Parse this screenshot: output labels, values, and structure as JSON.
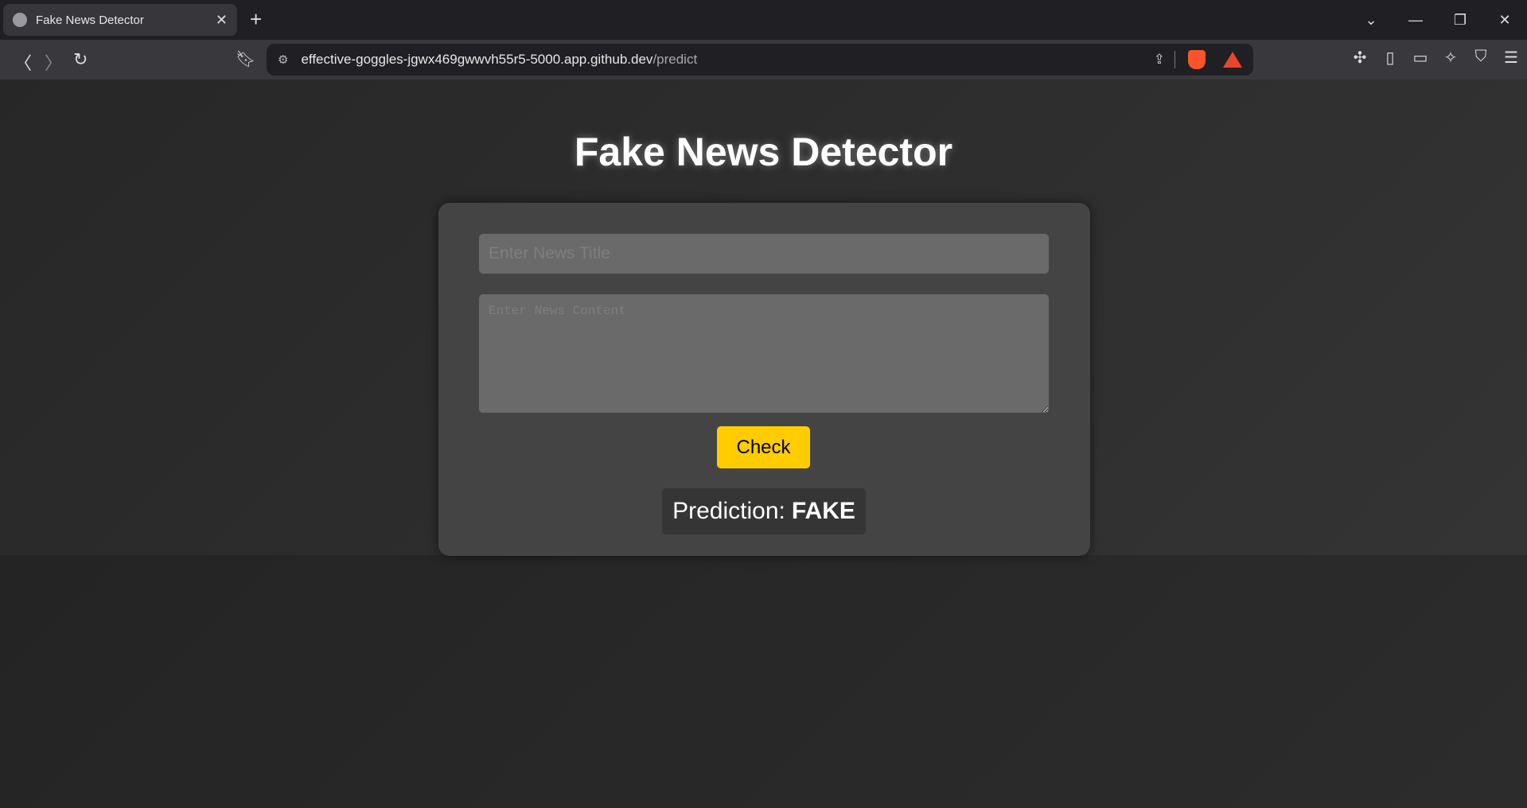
{
  "browser": {
    "tab": {
      "title": "Fake News Detector",
      "icon": "globe-icon"
    },
    "url": {
      "host": "effective-goggles-jgwx469gwwvh55r5-5000.app.github.dev",
      "path": "/predict"
    }
  },
  "page": {
    "title": "Fake News Detector",
    "title_input": {
      "placeholder": "Enter News Title",
      "value": ""
    },
    "content_input": {
      "placeholder": "Enter News Content",
      "value": ""
    },
    "check_label": "Check",
    "prediction_label": "Prediction:",
    "prediction_value": "FAKE"
  },
  "colors": {
    "accent": "#ffcc00",
    "card": "#444444",
    "input": "#6a6a6a"
  }
}
